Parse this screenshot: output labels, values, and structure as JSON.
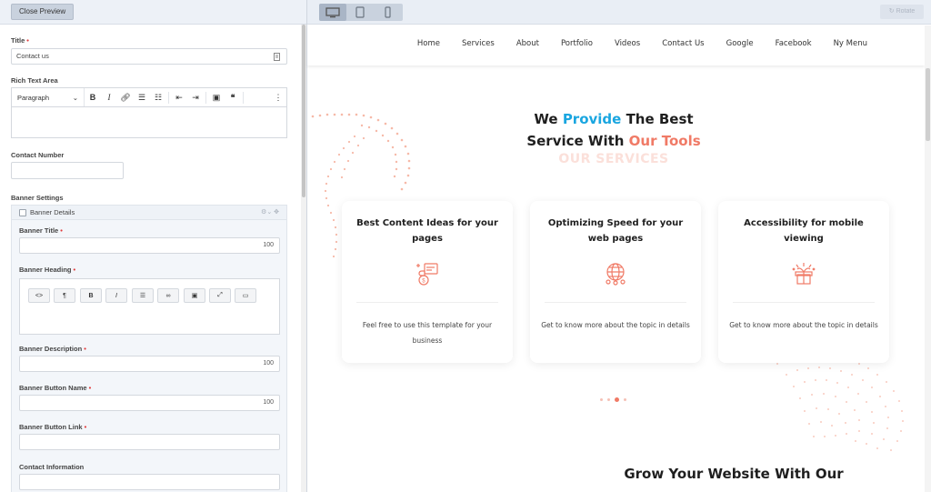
{
  "editor": {
    "close_preview": "Close Preview",
    "title_label": "Title",
    "title_value": "Contact us",
    "rich_text_label": "Rich Text Area",
    "paragraph_select": "Paragraph",
    "contact_number_label": "Contact Number",
    "banner_settings_label": "Banner Settings",
    "banner_details_label": "Banner Details",
    "banner_title_label": "Banner Title",
    "banner_title_count": "100",
    "banner_heading_label": "Banner Heading",
    "banner_description_label": "Banner Description",
    "banner_description_count": "100",
    "banner_button_name_label": "Banner Button Name",
    "banner_button_name_count": "100",
    "banner_button_link_label": "Banner Button Link",
    "contact_information_label": "Contact Information",
    "required_mark": "•"
  },
  "preview_toolbar": {
    "devices": [
      "desktop-icon",
      "tablet-icon",
      "mobile-icon"
    ],
    "active_device": "desktop",
    "rotate_label": "↻ Rotate"
  },
  "site": {
    "nav": [
      "Home",
      "Services",
      "About",
      "Portfolio",
      "Videos",
      "Contact Us",
      "Google",
      "Facebook",
      "Ny Menu"
    ],
    "heading_line1_a": "We ",
    "heading_line1_b": "Provide",
    "heading_line1_c": " The Best",
    "heading_line2_a": "Service With ",
    "heading_line2_b": "Our Tools",
    "ghost_text": "OUR SERVICES",
    "cards": [
      {
        "title": "Best Content Ideas for your pages",
        "icon": "content-ideas-icon",
        "desc": "Feel free to use this template for your business"
      },
      {
        "title": "Optimizing Speed for your web pages",
        "icon": "speed-globe-icon",
        "desc": "Get to know more about the topic in details"
      },
      {
        "title": "Accessibility for mobile viewing",
        "icon": "gift-box-icon",
        "desc": "Get to know more about the topic in details"
      }
    ],
    "carousel_pages": 4,
    "carousel_active": 3,
    "bottom_heading": "Grow Your Website With Our"
  },
  "colors": {
    "accent_blue": "#1aa6e0",
    "accent_coral": "#f07a66",
    "required_red": "#e03a3a"
  }
}
